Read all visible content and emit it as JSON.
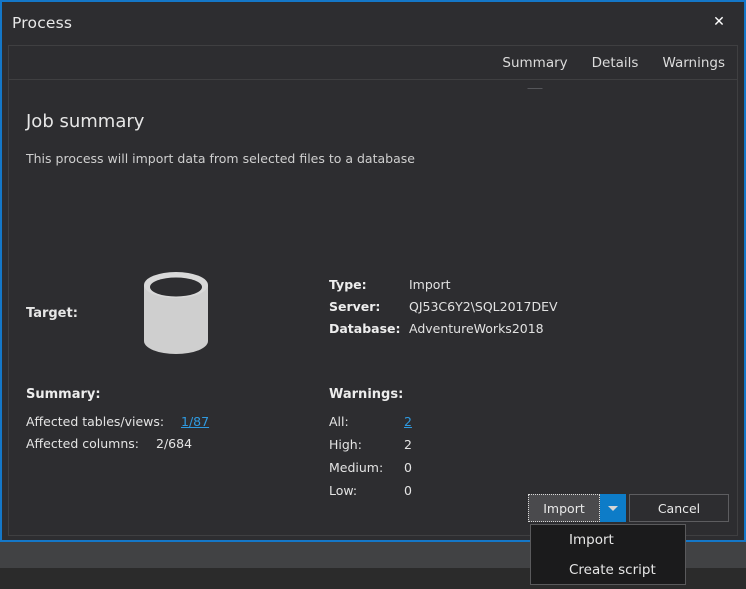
{
  "window": {
    "title": "Process",
    "close_label": "✕"
  },
  "tabs": [
    {
      "label": "Summary",
      "active": true
    },
    {
      "label": "Details",
      "active": false
    },
    {
      "label": "Warnings",
      "active": false
    }
  ],
  "main": {
    "heading": "Job summary",
    "subheading": "This process will import data from selected files to a database",
    "target_label": "Target:",
    "target_icon": "database-cylinder-icon",
    "details": [
      {
        "key": "Type:",
        "value": "Import"
      },
      {
        "key": "Server:",
        "value": "QJ53C6Y2\\SQL2017DEV"
      },
      {
        "key": "Database:",
        "value": "AdventureWorks2018"
      }
    ],
    "summary": {
      "title": "Summary:",
      "rows": [
        {
          "key": "Affected tables/views:",
          "value": "1/87",
          "is_link": true
        },
        {
          "key": "Affected columns:",
          "value": "2/684",
          "is_link": false
        }
      ]
    },
    "warnings": {
      "title": "Warnings:",
      "rows": [
        {
          "key": "All:",
          "value": "2",
          "is_link": true
        },
        {
          "key": "High:",
          "value": "2",
          "is_link": false
        },
        {
          "key": "Medium:",
          "value": "0",
          "is_link": false
        },
        {
          "key": "Low:",
          "value": "0",
          "is_link": false
        }
      ]
    }
  },
  "footer": {
    "primary_label": "Import",
    "dropdown_icon": "chevron-down-icon",
    "cancel_label": "Cancel"
  },
  "dropdown_menu": {
    "items": [
      {
        "label": "Import"
      },
      {
        "label": "Create script"
      }
    ]
  },
  "colors": {
    "accent_blue": "#1477c8",
    "split_arrow_blue": "#0d7cc8",
    "link_blue": "#2f9ae0",
    "dialog_bg": "#2d2d30",
    "menu_bg": "#1b1b1c",
    "band_gray": "#414244",
    "page_bg": "#2b2b2b"
  }
}
